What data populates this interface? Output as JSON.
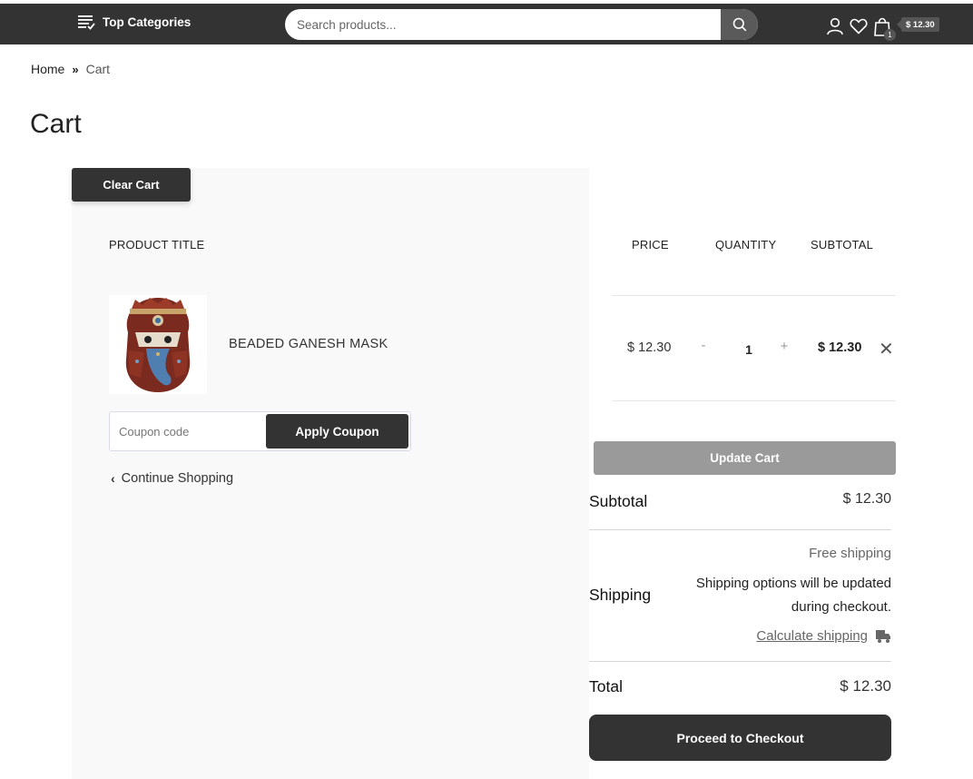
{
  "header": {
    "categories_label": "Top Categories",
    "search_placeholder": "Search products...",
    "cart_count": "1",
    "cart_total": "$ 12.30"
  },
  "breadcrumb": {
    "home": "Home",
    "separator": "»",
    "current": "Cart"
  },
  "page_title": "Cart",
  "cart": {
    "clear_label": "Clear Cart",
    "columns": {
      "product": "PRODUCT TITLE",
      "price": "PRICE",
      "quantity": "QUANTITY",
      "subtotal": "SUBTOTAL"
    },
    "items": [
      {
        "name": "BEADED GANESH MASK",
        "price": "$ 12.30",
        "qty_minus": "-",
        "quantity": "1",
        "qty_plus": "+",
        "subtotal": "$ 12.30",
        "remove": "✕"
      }
    ],
    "coupon_placeholder": "Coupon code",
    "apply_label": "Apply Coupon",
    "continue_label": "Continue Shopping",
    "update_label": "Update Cart"
  },
  "totals": {
    "subtotal_label": "Subtotal",
    "subtotal_value": "$ 12.30",
    "shipping_label": "Shipping",
    "shipping_method": "Free shipping",
    "shipping_note": "Shipping options will be updated during checkout.",
    "calc_shipping": "Calculate shipping",
    "total_label": "Total",
    "total_value": "$ 12.30",
    "checkout_label": "Proceed to Checkout"
  },
  "colors": {
    "header_bg": "#333333",
    "panel_bg": "#f9f9f9",
    "button_dark": "#333333",
    "button_disabled": "#9a9a9a"
  }
}
